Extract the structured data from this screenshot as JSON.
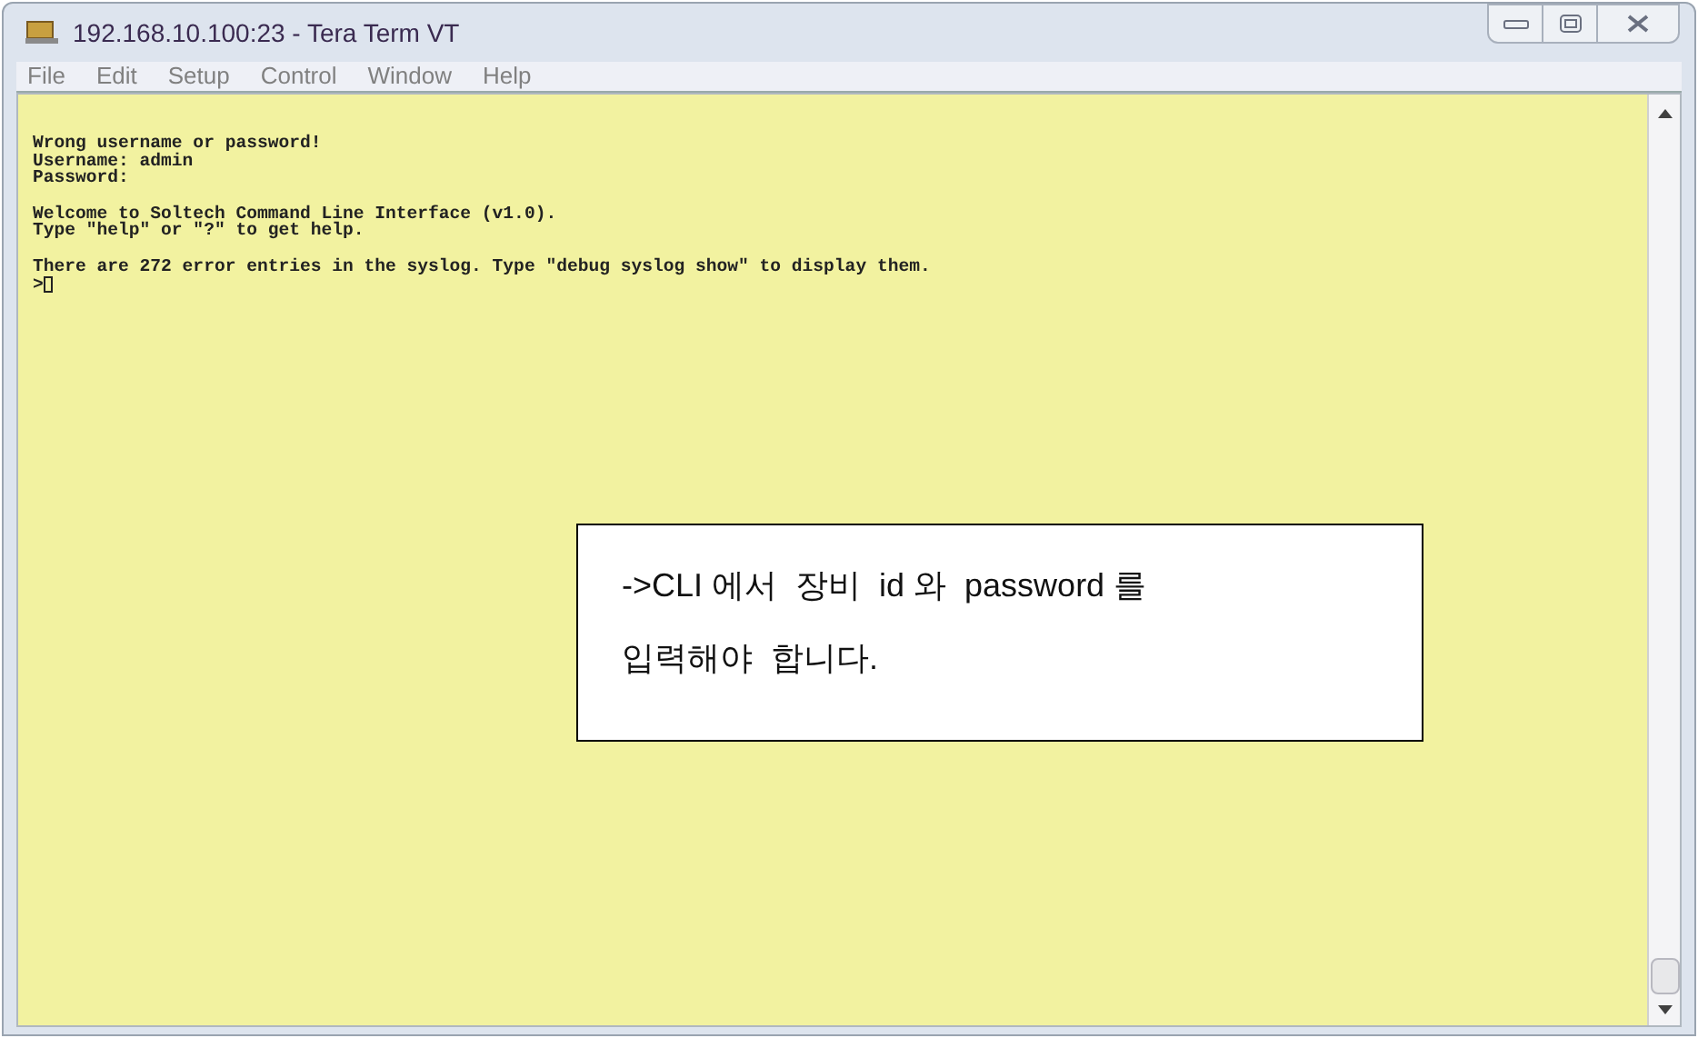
{
  "window": {
    "title": "192.168.10.100:23 - Tera Term VT"
  },
  "menu": [
    "File",
    "Edit",
    "Setup",
    "Control",
    "Window",
    "Help"
  ],
  "terminal": {
    "lines": [
      {
        "kind": "text",
        "text": "Wrong username or password!"
      },
      {
        "kind": "text",
        "text": "Username: admin"
      },
      {
        "kind": "text",
        "text": "Password:"
      },
      {
        "kind": "blank"
      },
      {
        "kind": "text",
        "text": "Welcome to Soltech Command Line Interface (v1.0)."
      },
      {
        "kind": "text",
        "text": "Type \"help\" or \"?\" to get help."
      },
      {
        "kind": "blank"
      },
      {
        "kind": "text",
        "text": "There are 272 error entries in the syslog. Type \"debug syslog show\" to display them."
      },
      {
        "kind": "prompt",
        "text": ">"
      }
    ]
  },
  "callout": {
    "lines": [
      "->CLI 에서  장비  id 와  password 를",
      "입력해야  합니다."
    ]
  }
}
